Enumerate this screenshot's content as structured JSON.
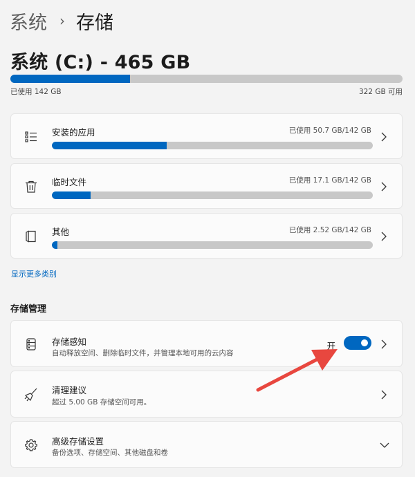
{
  "breadcrumb": {
    "parent": "系统",
    "separator": "›",
    "current": "存储"
  },
  "drive": {
    "title": "系统 (C:) - 465 GB",
    "used_label": "已使用 142 GB",
    "free_label": "322 GB 可用",
    "used_fraction": 0.305
  },
  "categories": [
    {
      "name": "安装的应用",
      "usage": "已使用 50.7 GB/142 GB",
      "fraction": 0.357,
      "icon": "app-list-icon"
    },
    {
      "name": "临时文件",
      "usage": "已使用 17.1 GB/142 GB",
      "fraction": 0.12,
      "icon": "trash-icon"
    },
    {
      "name": "其他",
      "usage": "已使用 2.52 GB/142 GB",
      "fraction": 0.018,
      "icon": "folder-icon"
    }
  ],
  "more_link": "显示更多类别",
  "storage_management": {
    "title": "存储管理",
    "storage_sense": {
      "title": "存储感知",
      "desc": "自动释放空间、删除临时文件，并管理本地可用的云内容",
      "toggle_label": "开",
      "enabled": true
    },
    "cleanup": {
      "title": "清理建议",
      "desc": "超过 5.00 GB 存储空间可用。"
    },
    "advanced": {
      "title": "高级存储设置",
      "desc": "备份选项、存储空间、其他磁盘和卷"
    }
  },
  "colors": {
    "accent": "#0067c0",
    "arrow": "#e8473f"
  }
}
